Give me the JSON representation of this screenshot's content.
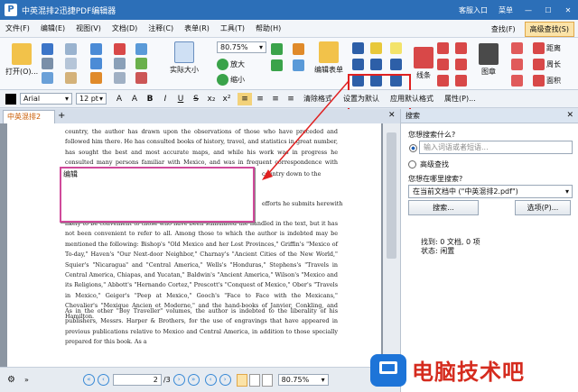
{
  "window": {
    "title": "中英混排2迅捷PDF编辑器",
    "customer_service": "客服入口",
    "menu_label": "菜单"
  },
  "menubar": {
    "items": [
      "文件(F)",
      "编辑(E)",
      "视图(V)",
      "文档(D)",
      "注释(C)",
      "表单(R)",
      "工具(T)",
      "帮助(H)"
    ],
    "find": "查找(F)",
    "advanced_find": "高级查找(S)"
  },
  "ribbon": {
    "open": "打开(O)...",
    "actual_size": "实际大小",
    "zoom_value": "80.75%",
    "zoom_in": "放大",
    "zoom_out": "缩小",
    "edit_form": "编辑表单",
    "lines": "线条",
    "figure": "图章",
    "distance": "距离",
    "perimeter": "周长",
    "area": "面积"
  },
  "format": {
    "font": "Arial",
    "size": "12 pt",
    "clear_format": "清除格式",
    "set_default": "设置为默认",
    "apply_default": "应用默认格式",
    "properties": "属性(P)..."
  },
  "document": {
    "tab_name": "中英混排2",
    "para1": "country, the author has drawn upon the observations of those who have preceded and followed him there. He has consulted books of history, travel, and statistics in great number, has sought the best and most accurate maps, and while his work was in progress he consulted many persons familiar with Mexico, and was in frequent correspondence with gentlemen now residing there.",
    "frag1": "country down to the",
    "frag2": "efforts he submits herewith",
    "para2": "likely to be convenient to those who have been stimulated the handled in the text, but it has not been convenient to refer to all. Among those to which the author is indebted may be mentioned the following: Bishop's \"Old Mexico and her Lost Provinces,\" Griffin's \"Mexico of To-day,\" Haven's \"Our Next-door Neighbor,\" Charnay's \"Ancient Cities of the New World,\" Squier's \"Nicaragua\" and \"Central America,\" Wells's \"Honduras,\" Stephens's \"Travels in Central America, Chiapas, and Yucatan,\" Baldwin's \"Ancient America,\" Wilson's \"Mexico and its Religions,\" Abbott's \"Hernando Cortez,\" Prescott's \"Conquest of Mexico,\" Ober's \"Travels in Mexico,\" Geiger's \"Peep at Mexico,\" Gooch's \"Face to Face with the Mexicans,\" Chevalier's \"Mexique Ancien et Moderne,\" and the hand-books of Janvier, Conkling, and Hamilton.",
    "para3": "As in the other \"Boy Traveller\" volumes, the author is indebted to the liberality of his publishers, Messrs. Harper & Brothers, for the use of engravings that have appeared in previous publications relative to Mexico and Central America, in addition to those specially prepared for this book. As a",
    "edit_box_text": "编辑"
  },
  "status": {
    "page": "2",
    "total": "/3",
    "zoom": "80.75%"
  },
  "search": {
    "panel_title": "搜索",
    "what_label": "您想搜索什么?",
    "input_placeholder": "输入词语或者短语...",
    "advanced": "高级查找",
    "where_label": "您想在哪里搜索?",
    "where_value": "在当前文档中 (\"中英混排2.pdf\")",
    "search_button": "搜索...",
    "options_button": "选项(P)...",
    "found": "找到: 0 文档, 0 项",
    "state": "状态: 闲置"
  },
  "watermark": {
    "text": "电脑技术吧"
  }
}
